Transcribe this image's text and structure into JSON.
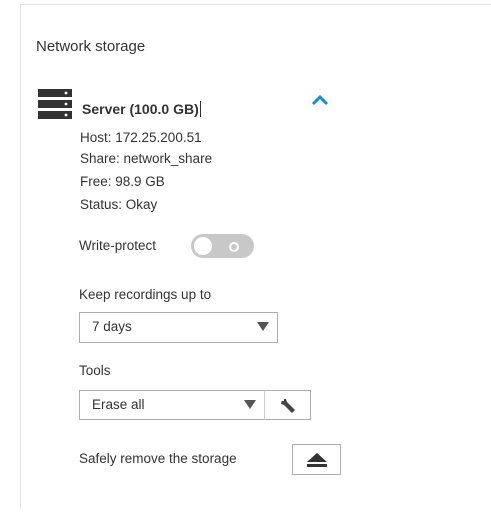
{
  "section": {
    "title": "Network storage"
  },
  "server": {
    "name": "Server (100.0 GB)",
    "host": "Host: 172.25.200.51",
    "share": "Share: network_share",
    "free": "Free: 98.9 GB",
    "status": "Status: Okay"
  },
  "write_protect": {
    "label": "Write-protect",
    "enabled": false
  },
  "retention": {
    "label": "Keep recordings up to",
    "selected": "7 days"
  },
  "tools": {
    "label": "Tools",
    "selected": "Erase all"
  },
  "safely_remove": {
    "label": "Safely remove the storage"
  },
  "colors": {
    "accent": "#1a8ec6",
    "toggle_off": "#c8c8c8"
  },
  "icons": {
    "server": "server-icon",
    "collapse": "chevron-up-icon",
    "tool": "wrench-icon",
    "eject": "eject-icon"
  }
}
